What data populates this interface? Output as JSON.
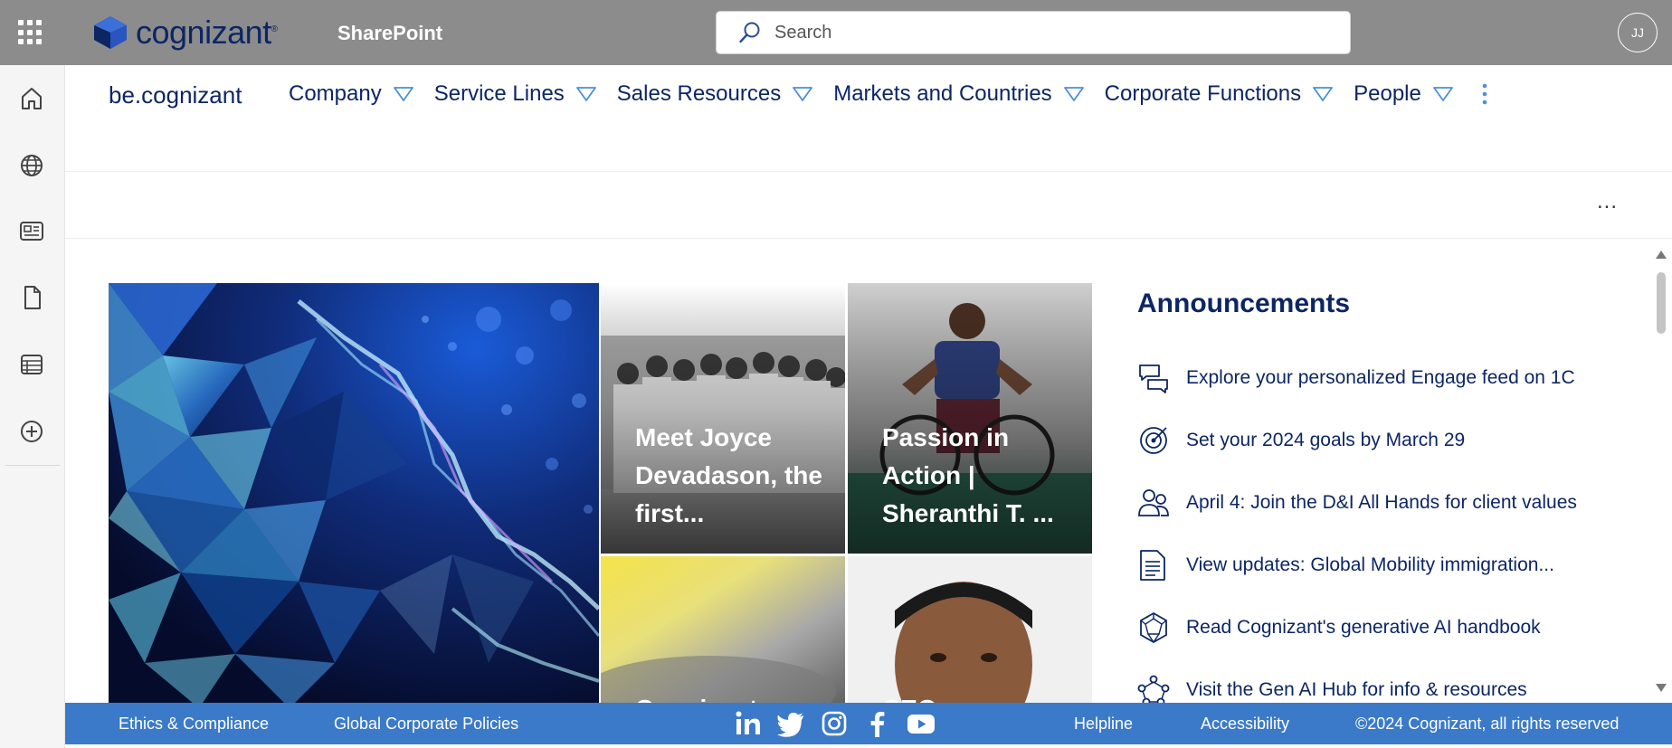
{
  "topbar": {
    "logo_text": "cognizant",
    "logo_mark": "®",
    "app_name": "SharePoint",
    "search_placeholder": "Search",
    "avatar_initials": "JJ"
  },
  "hub": {
    "title": "be.cognizant",
    "nav": [
      {
        "label": "Company"
      },
      {
        "label": "Service Lines"
      },
      {
        "label": "Sales Resources"
      },
      {
        "label": "Markets and Countries"
      },
      {
        "label": "Corporate Functions"
      },
      {
        "label": "People"
      }
    ]
  },
  "commandbar": {
    "more_label": "..."
  },
  "hero": {
    "tile1_caption": "Meet Joyce Devadason, the first...",
    "tile2_caption": "Passion in Action | Sheranthi T. ...",
    "tile3_caption": "Cognizant",
    "tile4_caption": "CEO"
  },
  "announcements": {
    "title": "Announcements",
    "items": [
      {
        "text": "Explore your personalized Engage feed on 1C",
        "icon": "chat-bubbles-icon"
      },
      {
        "text": "Set your 2024 goals by March 29",
        "icon": "target-icon"
      },
      {
        "text": "April 4: Join the D&I All Hands for client values",
        "icon": "people-icon"
      },
      {
        "text": "View updates: Global Mobility immigration...",
        "icon": "document-icon"
      },
      {
        "text": "Read Cognizant's generative AI handbook",
        "icon": "polyhedron-icon"
      },
      {
        "text": "Visit the Gen AI Hub for info & resources",
        "icon": "network-icon"
      }
    ]
  },
  "footer": {
    "ethics": "Ethics & Compliance",
    "policies": "Global Corporate Policies",
    "helpline": "Helpline",
    "accessibility": "Accessibility",
    "copyright": "©2024 Cognizant, all rights reserved"
  },
  "colors": {
    "topbar": "#8c8c8c",
    "brand_navy": "#0c2664",
    "footer": "#3b7ac8",
    "accent": "#4a90d9"
  }
}
